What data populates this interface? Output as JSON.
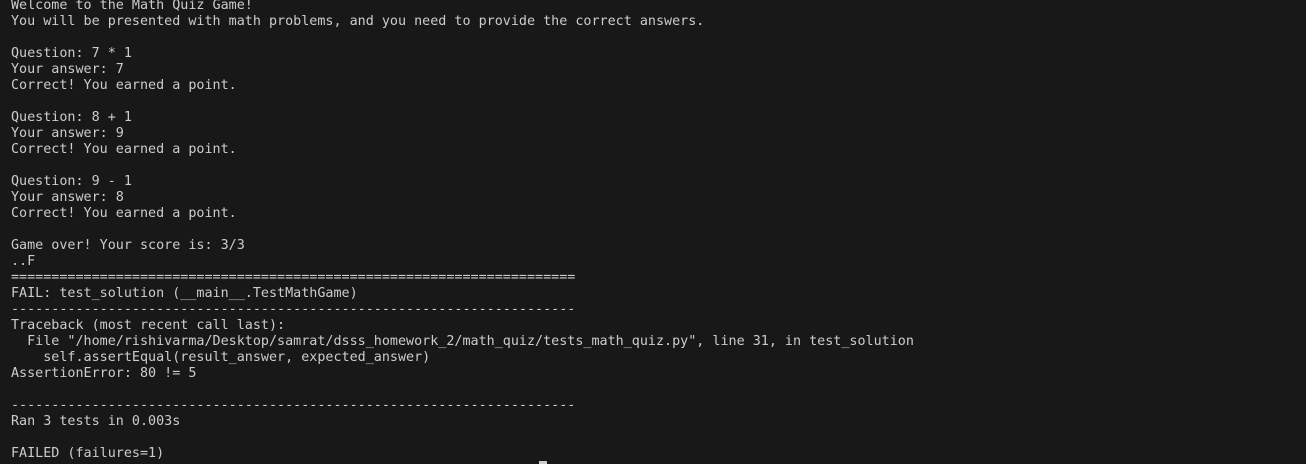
{
  "terminal": {
    "lines": [
      "Welcome to the Math Quiz Game!",
      "You will be presented with math problems, and you need to provide the correct answers.",
      "",
      "Question: 7 * 1",
      "Your answer: 7",
      "Correct! You earned a point.",
      "",
      "Question: 8 + 1",
      "Your answer: 9",
      "Correct! You earned a point.",
      "",
      "Question: 9 - 1",
      "Your answer: 8",
      "Correct! You earned a point.",
      "",
      "Game over! Your score is: 3/3",
      "..F",
      "======================================================================",
      "FAIL: test_solution (__main__.TestMathGame)",
      "----------------------------------------------------------------------",
      "Traceback (most recent call last):",
      "  File \"/home/rishivarma/Desktop/samrat/dsss_homework_2/math_quiz/tests_math_quiz.py\", line 31, in test_solution",
      "    self.assertEqual(result_answer, expected_answer)",
      "AssertionError: 80 != 5",
      "",
      "----------------------------------------------------------------------",
      "Ran 3 tests in 0.003s",
      "",
      "FAILED (failures=1)"
    ],
    "colors": {
      "background": "#181818",
      "text": "#cccccc"
    }
  }
}
